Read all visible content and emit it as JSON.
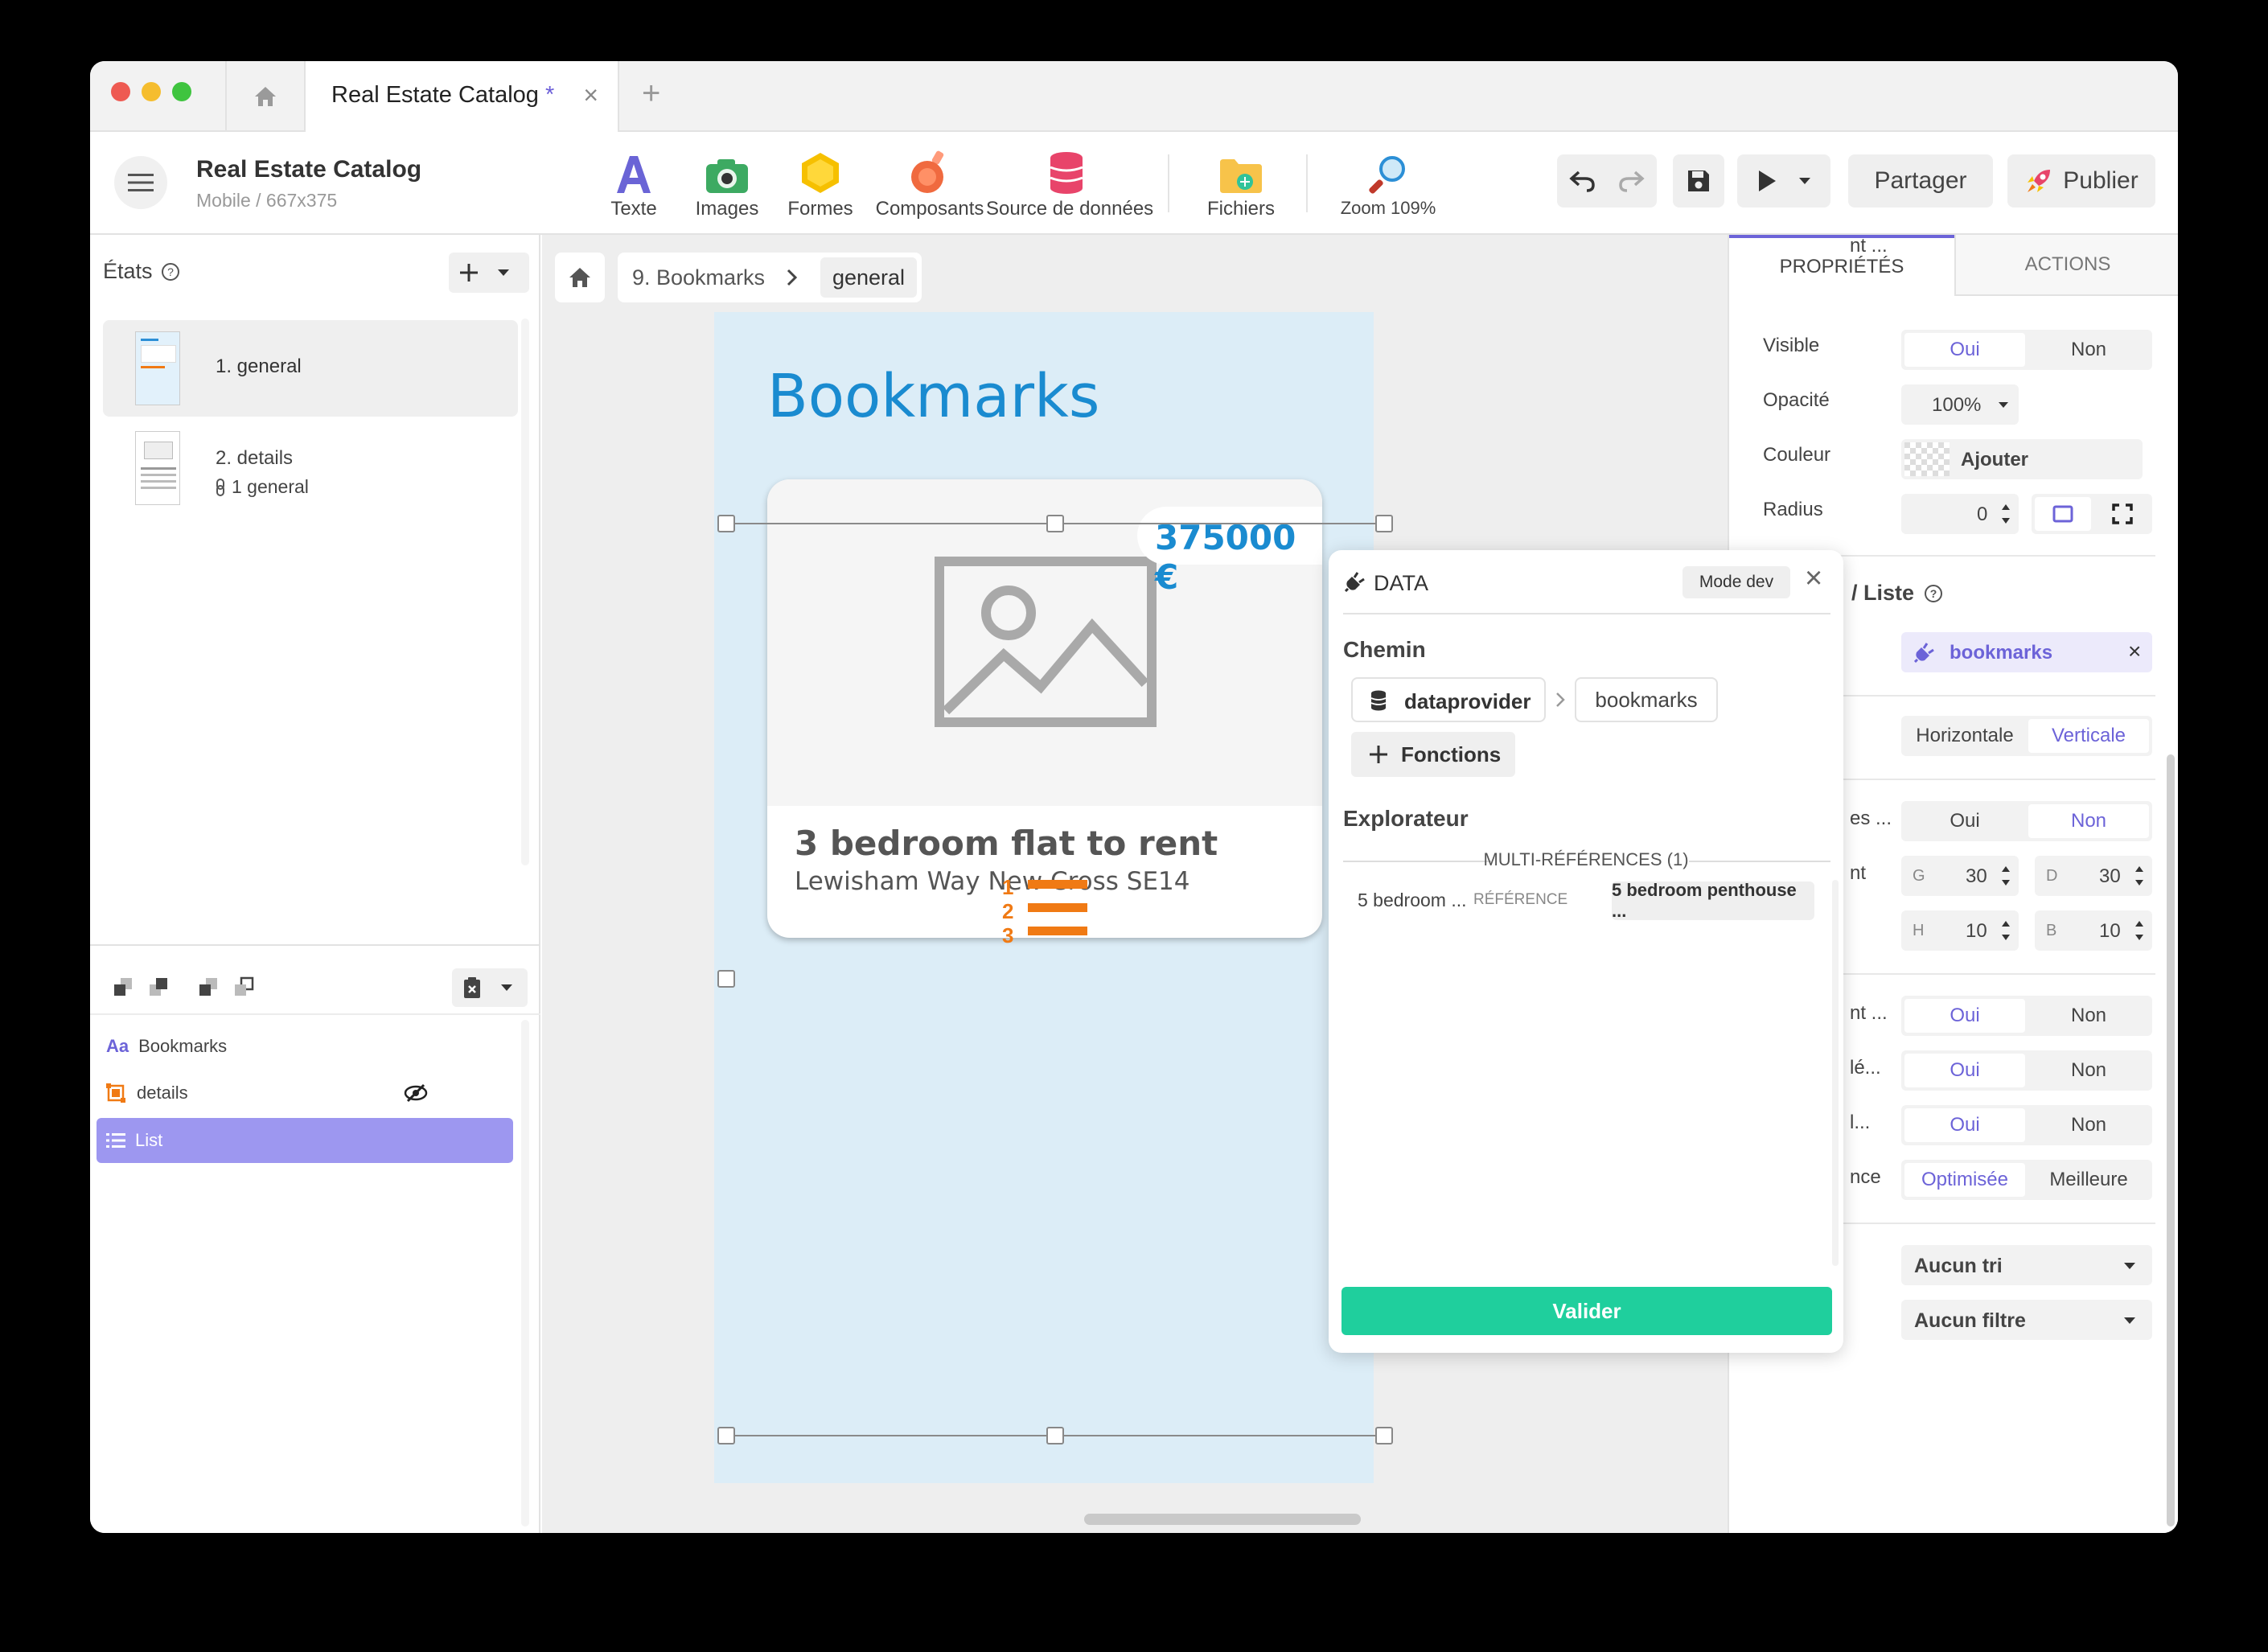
{
  "tabs": {
    "active_title": "Real Estate Catalog",
    "modified_mark": "*"
  },
  "app": {
    "title": "Real Estate Catalog",
    "subtitle": "Mobile / 667x375"
  },
  "tools": [
    {
      "label": "Texte",
      "icon": "text-icon"
    },
    {
      "label": "Images",
      "icon": "camera-icon"
    },
    {
      "label": "Formes",
      "icon": "hexagon-icon"
    },
    {
      "label": "Composants",
      "icon": "flask-icon"
    },
    {
      "label": "Source de données",
      "icon": "database-icon"
    },
    {
      "label": "Fichiers",
      "icon": "folder-add-icon"
    },
    {
      "label": "Zoom 109%",
      "icon": "magnifier-icon"
    }
  ],
  "actions": {
    "share": "Partager",
    "publish": "Publier"
  },
  "states": {
    "title": "États",
    "items": [
      {
        "label": "1. general",
        "sub": ""
      },
      {
        "label": "2. details",
        "sub": "1 general"
      }
    ]
  },
  "layers": [
    {
      "label": "Bookmarks",
      "icon": "text-layer-icon"
    },
    {
      "label": "details",
      "icon": "group-layer-icon",
      "hidden": true
    },
    {
      "label": "List",
      "icon": "list-layer-icon",
      "selected": true
    }
  ],
  "breadcrumb": {
    "screen": "9. Bookmarks",
    "state": "general"
  },
  "screen": {
    "heading": "Bookmarks",
    "card": {
      "price": "375000 €",
      "title": "3 bedroom flat to rent",
      "address": "Lewisham Way New Cross SE14"
    },
    "list_marker_numbers": [
      "1",
      "2",
      "3"
    ]
  },
  "data_popup": {
    "title": "DATA",
    "mode_dev": "Mode dev",
    "path_label": "Chemin",
    "path": [
      "dataprovider",
      "bookmarks"
    ],
    "functions": "Fonctions",
    "explorer_label": "Explorateur",
    "section": "MULTI-RÉFÉRENCES (1)",
    "row": {
      "name": "5 bedroom ...",
      "type": "RÉFÉRENCE",
      "value": "5 bedroom penthouse ..."
    },
    "submit": "Valider"
  },
  "props": {
    "tabs": [
      "PROPRIÉTÉS",
      "ACTIONS"
    ],
    "visible": {
      "label": "Visible",
      "options": [
        "Oui",
        "Non"
      ],
      "selected": "Oui"
    },
    "opacity": {
      "label": "Opacité",
      "value": "100%"
    },
    "color": {
      "label": "Couleur",
      "value": "Ajouter"
    },
    "radius": {
      "label": "Radius",
      "value": "0"
    },
    "data_section": "/ Liste",
    "data_binding": "bookmarks",
    "orientation": {
      "options": [
        "Horizontale",
        "Verticale"
      ],
      "selected": "Verticale"
    },
    "row1": {
      "label": "es ...",
      "options": [
        "Oui",
        "Non"
      ],
      "selected": "Non"
    },
    "padding": {
      "label": "nt",
      "g": "30",
      "d": "30",
      "h": "10",
      "b": "10",
      "g_label": "G",
      "d_label": "D",
      "h_label": "H",
      "b_label": "B"
    },
    "row2": {
      "label": "nt ...",
      "options": [
        "Oui",
        "Non"
      ],
      "selected": "Oui"
    },
    "row3": {
      "label": "lé...",
      "options": [
        "Oui",
        "Non"
      ],
      "selected": "Oui"
    },
    "row4": {
      "label": "l...",
      "options": [
        "Oui",
        "Non"
      ],
      "selected": "Oui"
    },
    "row5": {
      "label": "nce",
      "options": [
        "Optimisée",
        "Meilleure"
      ],
      "selected": "Optimisée"
    },
    "sort": "Aucun tri",
    "filter": "Aucun filtre"
  },
  "colors": {
    "accent": "#6c63d8",
    "screen_bg": "#dcedf7",
    "heading_blue": "#1a8bd0",
    "valider": "#1fcf9d",
    "list_orange": "#f07a14"
  }
}
